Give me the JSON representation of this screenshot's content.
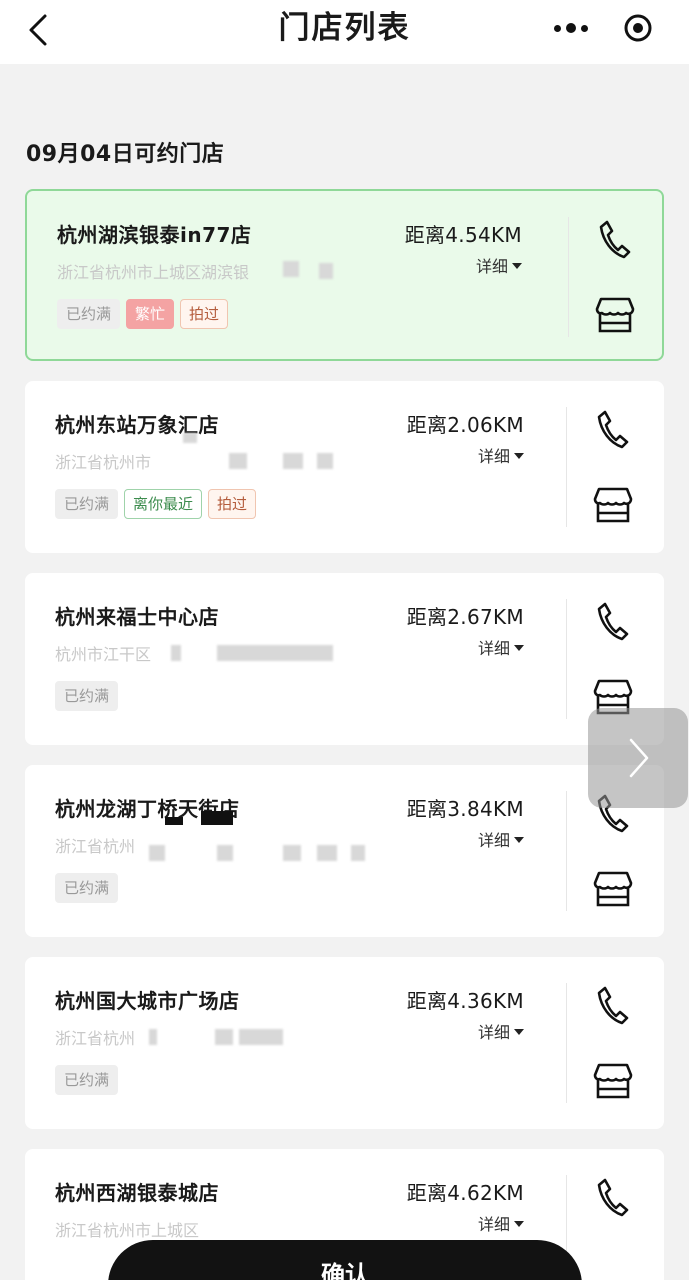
{
  "header": {
    "title": "门店列表",
    "back_icon": "chevron-left-icon",
    "more_icon": "more-dots-icon",
    "close_icon": "target-circle-icon"
  },
  "date_heading": "09月04日可约门店",
  "colors": {
    "selected_bg": "#eafaea",
    "selected_border": "#8fd898",
    "busy_tag": "#f4a3a3",
    "nearest_tag": "#3c8c4e"
  },
  "stores": [
    {
      "name": "杭州湖滨银泰in77店",
      "address": "浙江省杭州市上城区湖滨银",
      "distance": "距离4.54KM",
      "detail": "详细",
      "selected": true,
      "tags": [
        {
          "text": "已约满",
          "style": "gray"
        },
        {
          "text": "繁忙",
          "style": "red"
        },
        {
          "text": "拍过",
          "style": "orange"
        }
      ]
    },
    {
      "name": "杭州东站万象汇店",
      "address": "浙江省杭州市",
      "distance": "距离2.06KM",
      "detail": "详细",
      "selected": false,
      "tags": [
        {
          "text": "已约满",
          "style": "gray"
        },
        {
          "text": "离你最近",
          "style": "green"
        },
        {
          "text": "拍过",
          "style": "orange"
        }
      ]
    },
    {
      "name": "杭州来福士中心店",
      "address": "杭州市江干区",
      "distance": "距离2.67KM",
      "detail": "详细",
      "selected": false,
      "tags": [
        {
          "text": "已约满",
          "style": "gray"
        }
      ]
    },
    {
      "name": "杭州龙湖丁桥天街店",
      "address": "浙江省杭州",
      "distance": "距离3.84KM",
      "detail": "详细",
      "selected": false,
      "tags": [
        {
          "text": "已约满",
          "style": "gray"
        }
      ]
    },
    {
      "name": "杭州国大城市广场店",
      "address": "浙江省杭州",
      "distance": "距离4.36KM",
      "detail": "详细",
      "selected": false,
      "tags": [
        {
          "text": "已约满",
          "style": "gray"
        }
      ]
    },
    {
      "name": "杭州西湖银泰城店",
      "address": "浙江省杭州市上城区",
      "distance": "距离4.62KM",
      "detail": "详细",
      "selected": false,
      "tags": []
    }
  ],
  "confirm_label": "确认"
}
